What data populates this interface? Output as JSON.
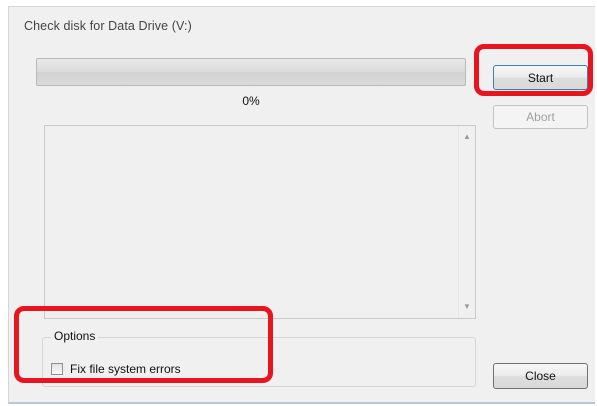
{
  "dialog": {
    "title": "Check disk for Data Drive (V:)"
  },
  "progress": {
    "value": 0,
    "label": "0%"
  },
  "buttons": {
    "start": "Start",
    "abort": "Abort",
    "close": "Close"
  },
  "options": {
    "legend": "Options",
    "fix_errors_label": "Fix file system errors",
    "fix_errors_checked": false
  },
  "colors": {
    "highlight": "#e8141e"
  },
  "icons": {
    "scroll_up": "scroll-up-arrow-icon",
    "scroll_down": "scroll-down-arrow-icon"
  }
}
